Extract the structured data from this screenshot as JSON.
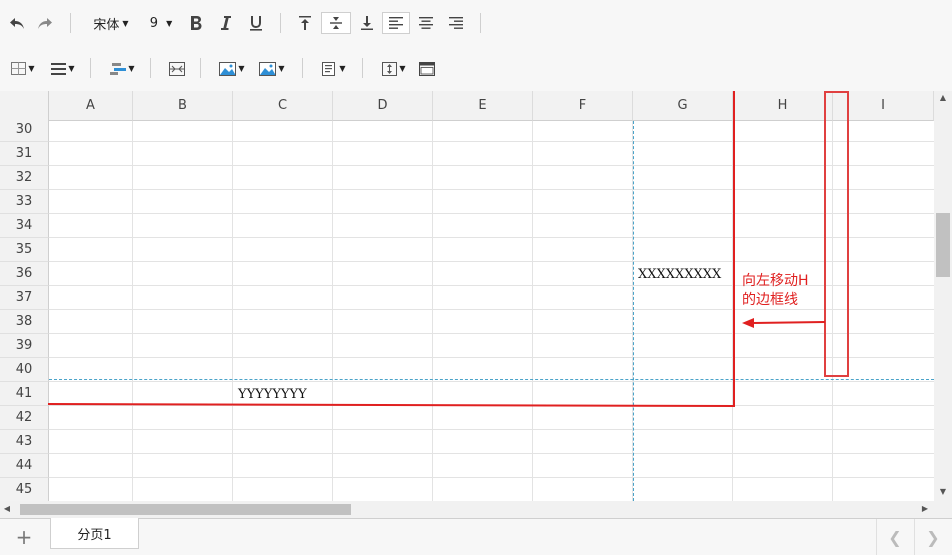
{
  "toolbar": {
    "font_family": "宋体",
    "font_size": "9"
  },
  "grid": {
    "columns": [
      "A",
      "B",
      "C",
      "D",
      "E",
      "F",
      "G",
      "H",
      "I"
    ],
    "rows": [
      "30",
      "31",
      "32",
      "33",
      "34",
      "35",
      "36",
      "37",
      "38",
      "39",
      "40",
      "41",
      "42",
      "43",
      "44",
      "45"
    ],
    "cells": {
      "G36": "XXXXXXXXX",
      "C41": "YYYYYYYY"
    }
  },
  "annotation": {
    "line1": "向左移动H",
    "line2": "的边框线",
    "color": "#e02020"
  },
  "sheets": [
    "分页1"
  ]
}
